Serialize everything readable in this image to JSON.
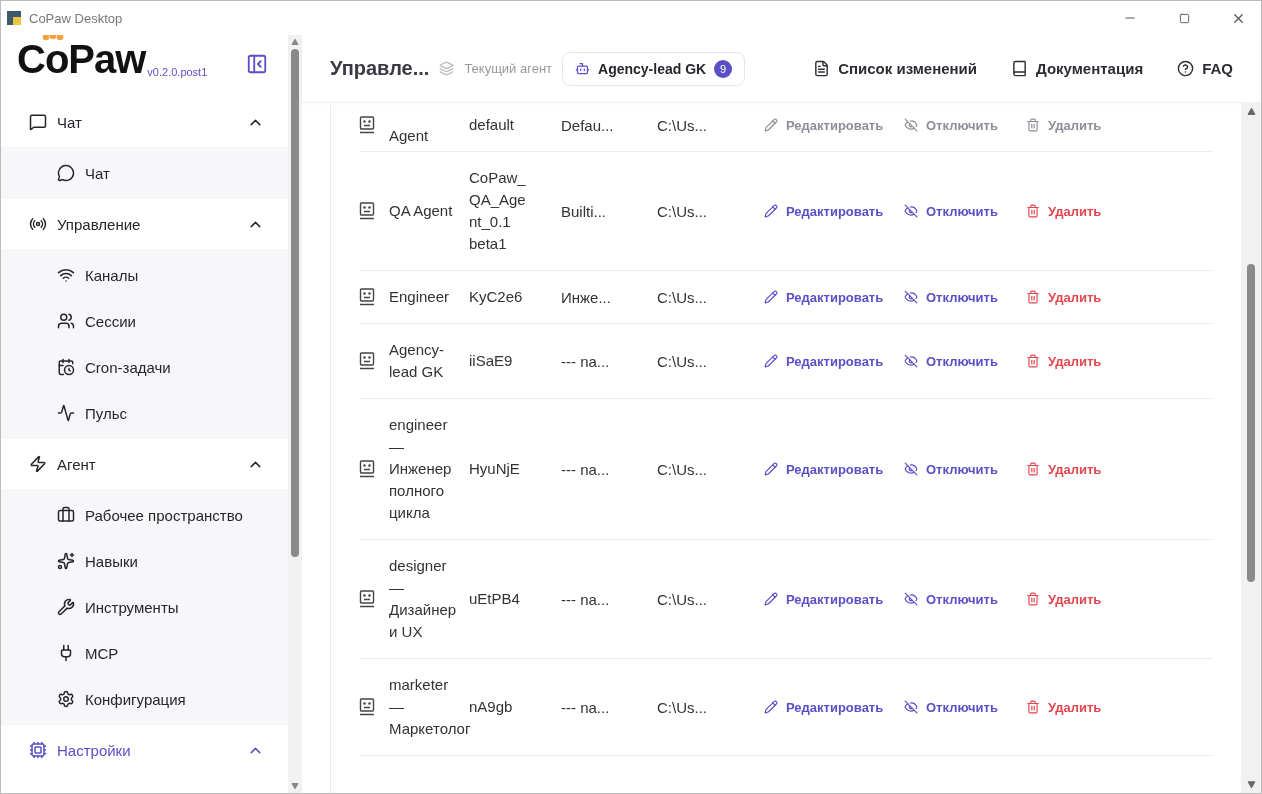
{
  "window": {
    "title": "CoPaw Desktop"
  },
  "sidebar": {
    "logo": "CoPaw",
    "version": "v0.2.0.post1",
    "groups": [
      {
        "label": "Чат",
        "kind": "chat",
        "expanded": true,
        "active": false,
        "items": [
          {
            "label": "Чат",
            "kind": "chat",
            "selected": false
          }
        ]
      },
      {
        "label": "Управление",
        "kind": "control",
        "expanded": true,
        "active": false,
        "items": [
          {
            "label": "Каналы",
            "kind": "channels",
            "selected": false
          },
          {
            "label": "Сессии",
            "kind": "sessions",
            "selected": false
          },
          {
            "label": "Cron-задачи",
            "kind": "cron",
            "selected": false
          },
          {
            "label": "Пульс",
            "kind": "pulse",
            "selected": false
          }
        ]
      },
      {
        "label": "Агент",
        "kind": "agent",
        "expanded": true,
        "active": false,
        "items": [
          {
            "label": "Рабочее пространство",
            "kind": "workspace",
            "selected": false
          },
          {
            "label": "Навыки",
            "kind": "skills",
            "selected": false
          },
          {
            "label": "Инструменты",
            "kind": "tools",
            "selected": false
          },
          {
            "label": "MCP",
            "kind": "mcp",
            "selected": false
          },
          {
            "label": "Конфигурация",
            "kind": "config",
            "selected": false
          }
        ]
      },
      {
        "label": "Настройки",
        "kind": "settings",
        "expanded": true,
        "active": true
      }
    ]
  },
  "header": {
    "title": "Управле...",
    "agent_label": "Текущий агент",
    "agent": {
      "name": "Agency-lead GK",
      "count": "9"
    },
    "links": [
      {
        "label": "Список изменений",
        "kind": "changelog"
      },
      {
        "label": "Документация",
        "kind": "docs"
      },
      {
        "label": "FAQ",
        "kind": "faq"
      }
    ]
  },
  "table": {
    "rows": [
      {
        "name": "Agent",
        "id": "default",
        "description": "Defau...",
        "path": "C:\\Us...",
        "disabled": true,
        "actions": [
          {
            "label": "Редактировать",
            "kind": "edit"
          },
          {
            "label": "Отключить",
            "kind": "disable"
          },
          {
            "label": "Удалить",
            "kind": "delete"
          }
        ]
      },
      {
        "name": "QA Agent",
        "id": "CoPaw_QA_Agent_0.1 beta1",
        "description": "Builti...",
        "path": "C:\\Us...",
        "disabled": false,
        "actions": [
          {
            "label": "Редактировать",
            "kind": "edit"
          },
          {
            "label": "Отключить",
            "kind": "disable"
          },
          {
            "label": "Удалить",
            "kind": "delete"
          }
        ]
      },
      {
        "name": "Engineer",
        "id": "KyC2e6",
        "description": "Инже...",
        "path": "C:\\Us...",
        "disabled": false,
        "actions": [
          {
            "label": "Редактировать",
            "kind": "edit"
          },
          {
            "label": "Отключить",
            "kind": "disable"
          },
          {
            "label": "Удалить",
            "kind": "delete"
          }
        ]
      },
      {
        "name": "Agency-lead GK",
        "id": "iiSaE9",
        "description": "--- na...",
        "path": "C:\\Us...",
        "disabled": false,
        "actions": [
          {
            "label": "Редактировать",
            "kind": "edit"
          },
          {
            "label": "Отключить",
            "kind": "disable"
          },
          {
            "label": "Удалить",
            "kind": "delete"
          }
        ]
      },
      {
        "name": "engineer — Инженер полного цикла",
        "id": "HyuNjE",
        "description": "--- na...",
        "path": "C:\\Us...",
        "disabled": false,
        "actions": [
          {
            "label": "Редактировать",
            "kind": "edit"
          },
          {
            "label": "Отключить",
            "kind": "disable"
          },
          {
            "label": "Удалить",
            "kind": "delete"
          }
        ]
      },
      {
        "name": "designer — Дизайнер и UX",
        "id": "uEtPB4",
        "description": "--- na...",
        "path": "C:\\Us...",
        "disabled": false,
        "actions": [
          {
            "label": "Редактировать",
            "kind": "edit"
          },
          {
            "label": "Отключить",
            "kind": "disable"
          },
          {
            "label": "Удалить",
            "kind": "delete"
          }
        ]
      },
      {
        "name": "marketer — Маркетолог",
        "id": "nA9gb",
        "description": "--- na...",
        "path": "C:\\Us...",
        "disabled": false,
        "actions": [
          {
            "label": "Редактировать",
            "kind": "edit"
          },
          {
            "label": "Отключить",
            "kind": "disable"
          },
          {
            "label": "Удалить",
            "kind": "delete"
          }
        ]
      }
    ]
  }
}
